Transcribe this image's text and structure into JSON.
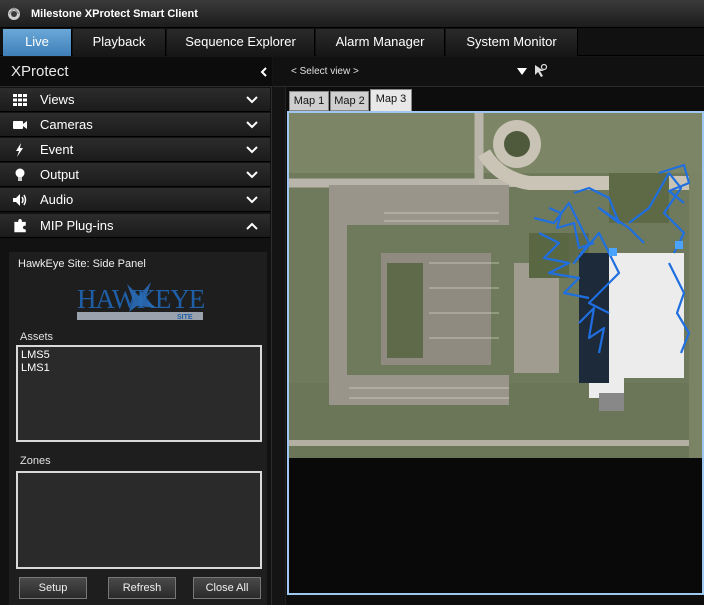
{
  "window": {
    "title": "Milestone XProtect Smart Client"
  },
  "tabs": [
    {
      "label": "Live"
    },
    {
      "label": "Playback"
    },
    {
      "label": "Sequence Explorer"
    },
    {
      "label": "Alarm Manager"
    },
    {
      "label": "System Monitor"
    }
  ],
  "sidebar": {
    "title": "XProtect",
    "items": [
      {
        "label": "Views",
        "icon": "grid-icon"
      },
      {
        "label": "Cameras",
        "icon": "camera-icon"
      },
      {
        "label": "Event",
        "icon": "lightning-icon"
      },
      {
        "label": "Output",
        "icon": "lightbulb-icon"
      },
      {
        "label": "Audio",
        "icon": "speaker-icon"
      },
      {
        "label": "MIP Plug-ins",
        "icon": "puzzle-icon"
      }
    ]
  },
  "plugin_panel": {
    "site_label": "HawkEye Site: Side Panel",
    "logo_text": "HAWKEYE",
    "logo_sub": "SITE",
    "assets_label": "Assets",
    "assets": [
      "LMS5",
      "LMS1"
    ],
    "zones_label": "Zones",
    "buttons": {
      "setup": "Setup",
      "refresh": "Refresh",
      "close_all": "Close All"
    }
  },
  "view_toolbar": {
    "select_view": "< Select view >"
  },
  "map_tabs": [
    {
      "label": "Map 1"
    },
    {
      "label": "Map 2"
    },
    {
      "label": "Map 3"
    }
  ],
  "colors": {
    "active_tab": "#4a8bc4",
    "map_frame": "#9ec8ef",
    "track_color": "#1f6fe0"
  }
}
